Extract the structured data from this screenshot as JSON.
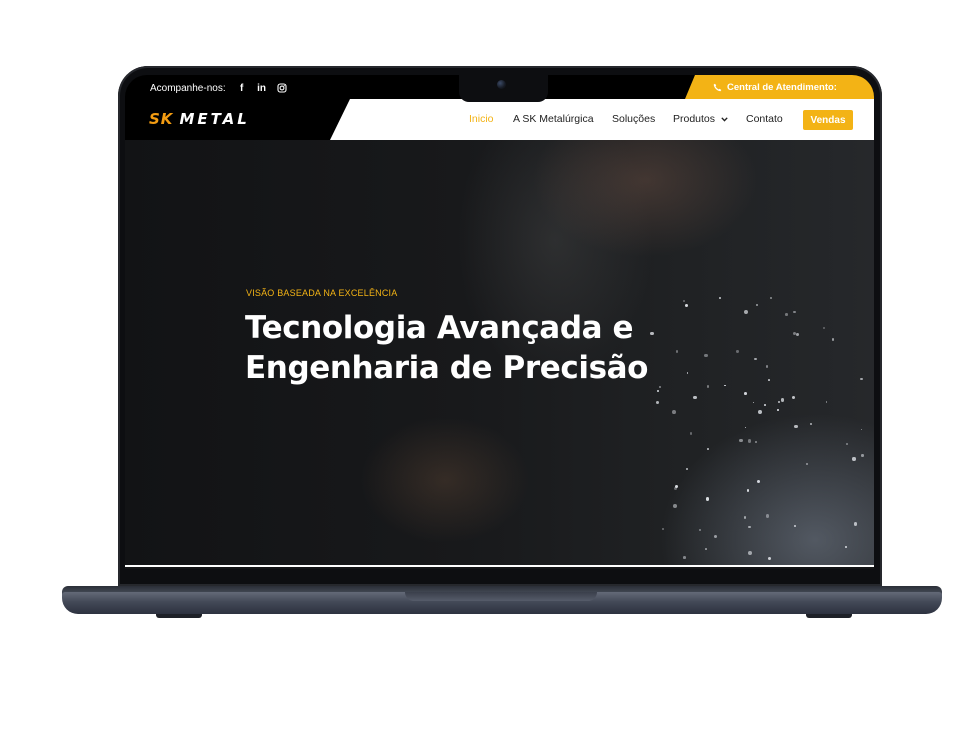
{
  "topbar": {
    "follow_label": "Acompanhe-nos:",
    "social": [
      {
        "icon": "facebook-icon",
        "glyph": "f"
      },
      {
        "icon": "linkedin-icon",
        "glyph": "in"
      },
      {
        "icon": "instagram-icon",
        "glyph": ""
      }
    ],
    "call_center_label": "Central de Atendimento:",
    "call_icon": "phone-icon"
  },
  "brand": {
    "logo_sk": "SK",
    "logo_metal": "METAL"
  },
  "nav": {
    "items": [
      {
        "label": "Inicio",
        "active": true
      },
      {
        "label": "A SK Metalúrgica",
        "active": false
      },
      {
        "label": "Soluções",
        "active": false
      },
      {
        "label": "Produtos",
        "active": false,
        "has_dropdown": true
      },
      {
        "label": "Contato",
        "active": false
      }
    ],
    "cta_label": "Vendas"
  },
  "hero": {
    "kicker": "VISÃO BASEADA NA EXCELÊNCIA",
    "headline_line1": "Tecnologia Avançada e",
    "headline_line2": "Engenharia de Precisão"
  },
  "colors": {
    "accent": "#f3b315",
    "logo_orange": "#f39c12",
    "dark": "#000000"
  }
}
